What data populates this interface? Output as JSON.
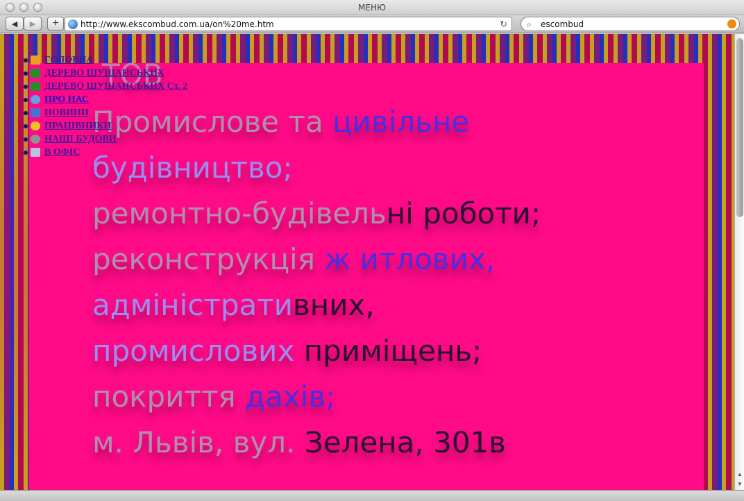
{
  "window": {
    "title": "МЕНЮ"
  },
  "toolbar": {
    "back_label": "◀",
    "forward_label": "▶",
    "add_label": "+",
    "url": "http://www.ekscombud.com.ua/on%20me.htm",
    "reload_label": "↻",
    "search_text": "escombud"
  },
  "menu": {
    "items": [
      {
        "label": "ГОЛОВНА",
        "icon": "home-icon",
        "color": "#f0a020"
      },
      {
        "label": "ДЕРЕВО ШУШАНСЬКИХ",
        "icon": "tree-icon",
        "color": "#2a8a2a"
      },
      {
        "label": "ДЕРЕВО ШУШАНСЬКИХ Ст. 2",
        "icon": "tree-icon",
        "color": "#2a8a2a"
      },
      {
        "label": "ПРО НАС",
        "icon": "people-icon",
        "color": "#6aa0e0"
      },
      {
        "label": "НОВИНИ",
        "icon": "book-icon",
        "color": "#4a70d0"
      },
      {
        "label": "ПРАЦІВНИКИ",
        "icon": "sun-icon",
        "color": "#f0c020"
      },
      {
        "label": "НАШІ БУДОВИ",
        "icon": "gear-icon",
        "color": "#909090"
      },
      {
        "label": "В ОФІС",
        "icon": "mail-icon",
        "color": "#c0c0e0"
      }
    ]
  },
  "content": {
    "heading": "ТОВ",
    "lines": [
      {
        "a": "Промислове та ",
        "b": "цивільне"
      },
      {
        "a": "будівництво;",
        "b": ""
      },
      {
        "a": "ремонтно-будівель",
        "b": "ні роботи;"
      },
      {
        "a": "реконструкція ",
        "b": "ж итлових,"
      },
      {
        "a": "адміністрати",
        "b": "вних,"
      },
      {
        "a": "промислових ",
        "b": "приміщень;"
      },
      {
        "a": "покриття ",
        "b": "дахів;"
      },
      {
        "a": "м. Львів, вул. ",
        "b": "Зелена, 301в"
      }
    ]
  }
}
